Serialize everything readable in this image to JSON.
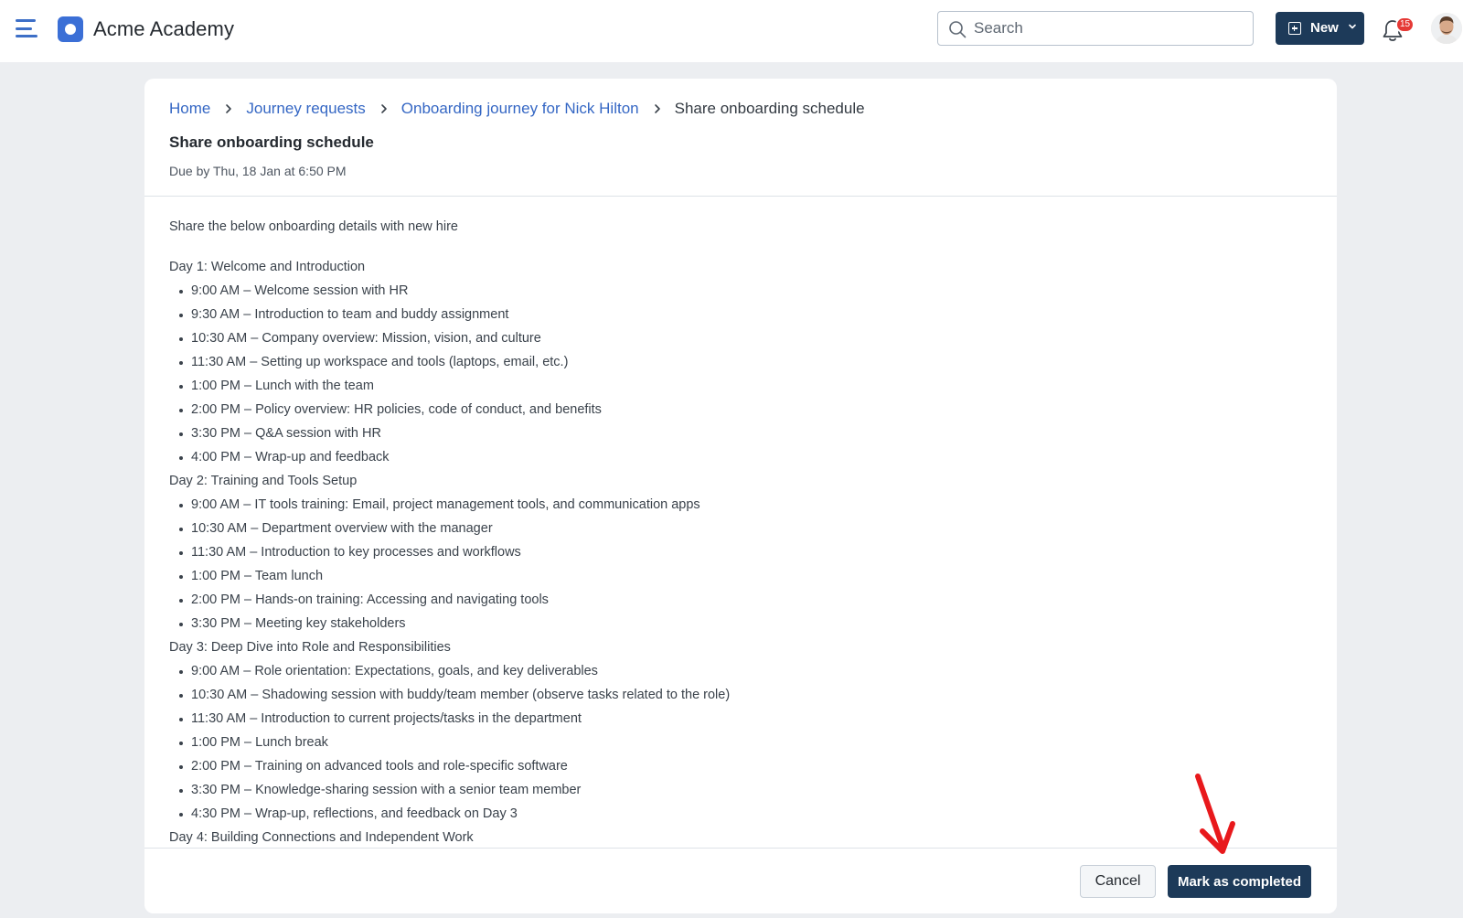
{
  "app": {
    "title": "Acme Academy"
  },
  "header": {
    "search": {
      "placeholder": "Search",
      "value": ""
    },
    "new_button_label": "New",
    "notifications_count": "15"
  },
  "breadcrumb": {
    "items": [
      "Home",
      "Journey requests",
      "Onboarding journey for Nick Hilton"
    ],
    "current": "Share onboarding schedule"
  },
  "task": {
    "title": "Share onboarding schedule",
    "due": "Due by Thu, 18 Jan at 6:50 PM"
  },
  "content": {
    "intro": "Share the below onboarding details with new hire",
    "days": [
      {
        "heading": "Day 1: Welcome and Introduction",
        "items": [
          "9:00 AM – Welcome session with HR",
          "9:30 AM – Introduction to team and buddy assignment",
          "10:30 AM – Company overview: Mission, vision, and culture",
          "11:30 AM – Setting up workspace and tools (laptops, email, etc.)",
          "1:00 PM – Lunch with the team",
          "2:00 PM – Policy overview: HR policies, code of conduct, and benefits",
          "3:30 PM – Q&A session with HR",
          "4:00 PM – Wrap-up and feedback"
        ]
      },
      {
        "heading": "Day 2: Training and Tools Setup",
        "items": [
          "9:00 AM – IT tools training: Email, project management tools, and communication apps",
          "10:30 AM – Department overview with the manager",
          "11:30 AM – Introduction to key processes and workflows",
          "1:00 PM – Team lunch",
          "2:00 PM – Hands-on training: Accessing and navigating tools",
          "3:30 PM – Meeting key stakeholders"
        ]
      },
      {
        "heading": "Day 3: Deep Dive into Role and Responsibilities",
        "items": [
          "9:00 AM – Role orientation: Expectations, goals, and key deliverables",
          "10:30 AM – Shadowing session with buddy/team member (observe tasks related to the role)",
          "11:30 AM – Introduction to current projects/tasks in the department",
          "1:00 PM – Lunch break",
          "2:00 PM – Training on advanced tools and role-specific software",
          "3:30 PM – Knowledge-sharing session with a senior team member",
          "4:30 PM – Wrap-up, reflections, and feedback on Day 3"
        ]
      },
      {
        "heading": "Day 4: Building Connections and Independent Work",
        "items": []
      }
    ]
  },
  "footer": {
    "cancel_label": "Cancel",
    "complete_label": "Mark as completed"
  },
  "colors": {
    "brand": "#3b6fd6",
    "primary_button": "#1d3a59",
    "link": "#3567c4",
    "badge": "#e53935",
    "annotation_arrow": "#e8191c"
  }
}
